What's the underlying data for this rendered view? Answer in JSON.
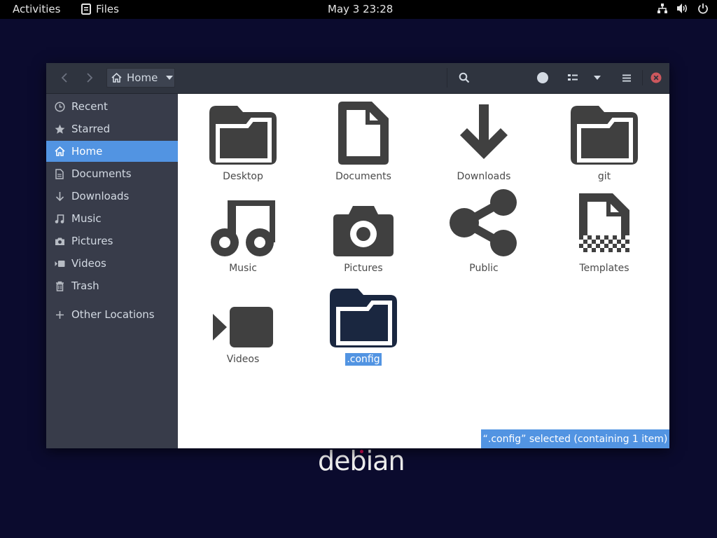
{
  "topbar": {
    "activities": "Activities",
    "app_name": "Files",
    "clock": "May 3  23:28",
    "icons": [
      "network-icon",
      "volume-icon",
      "power-icon"
    ]
  },
  "desktop": {
    "logo_text": "debian"
  },
  "window": {
    "pathbar": {
      "label": "Home"
    },
    "sidebar": {
      "items": [
        {
          "label": "Recent",
          "icon": "clock-icon"
        },
        {
          "label": "Starred",
          "icon": "star-icon"
        },
        {
          "label": "Home",
          "icon": "home-icon",
          "active": true
        },
        {
          "label": "Documents",
          "icon": "document-icon"
        },
        {
          "label": "Downloads",
          "icon": "download-icon"
        },
        {
          "label": "Music",
          "icon": "music-icon"
        },
        {
          "label": "Pictures",
          "icon": "camera-icon"
        },
        {
          "label": "Videos",
          "icon": "video-icon"
        },
        {
          "label": "Trash",
          "icon": "trash-icon"
        },
        {
          "label": "Other Locations",
          "icon": "plus-icon"
        }
      ]
    },
    "files": [
      {
        "label": "Desktop",
        "icon": "folder-icon"
      },
      {
        "label": "Documents",
        "icon": "document-icon"
      },
      {
        "label": "Downloads",
        "icon": "download-arrow-icon"
      },
      {
        "label": "git",
        "icon": "folder-icon"
      },
      {
        "label": "Music",
        "icon": "music-note-icon"
      },
      {
        "label": "Pictures",
        "icon": "camera-icon"
      },
      {
        "label": "Public",
        "icon": "share-icon"
      },
      {
        "label": "Templates",
        "icon": "template-icon"
      },
      {
        "label": "Videos",
        "icon": "video-camera-icon"
      },
      {
        "label": ".config",
        "icon": "folder-icon",
        "selected": true
      }
    ],
    "status": "“.config” selected  (containing 1 item)"
  },
  "colors": {
    "accent": "#5294e2",
    "headerbar": "#2f343f",
    "sidebar": "#383c4a",
    "desktop_bg": "#0b0b2e",
    "icon_gray": "#404040",
    "selected_folder": "#1a2740"
  }
}
